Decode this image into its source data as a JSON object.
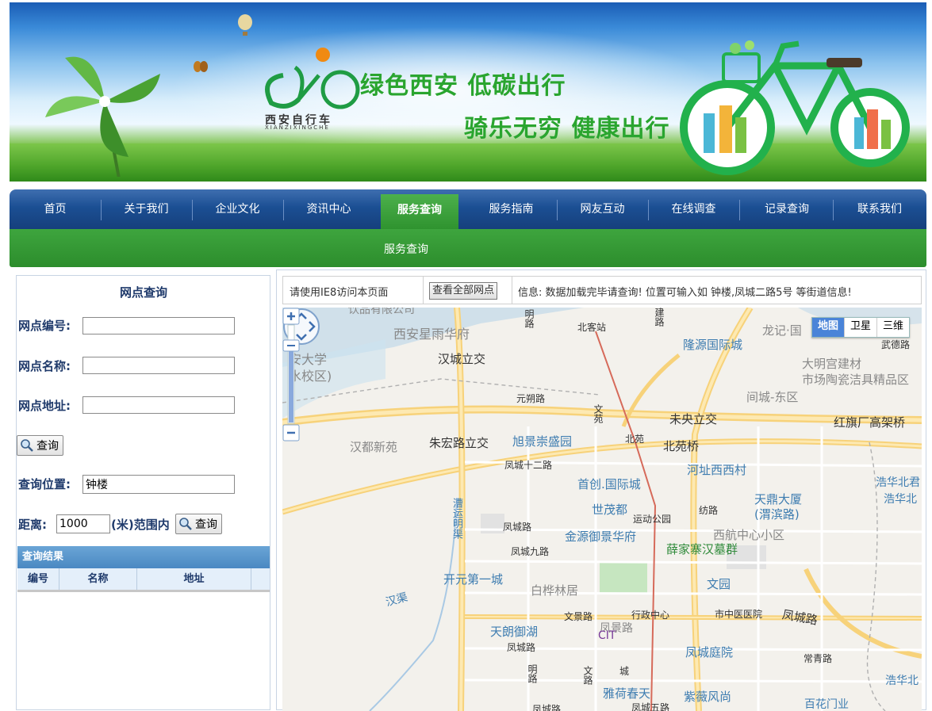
{
  "banner": {
    "logo_text": "西安自行车",
    "logo_sub": "XIANZIXINGCHE",
    "slogan1": "绿色西安 低碳出行",
    "slogan2": "骑乐无穷 健康出行"
  },
  "nav": {
    "items": [
      {
        "label": "首页"
      },
      {
        "label": "关于我们"
      },
      {
        "label": "企业文化"
      },
      {
        "label": "资讯中心"
      },
      {
        "label": "服务查询"
      },
      {
        "label": "服务指南"
      },
      {
        "label": "网友互动"
      },
      {
        "label": "在线调查"
      },
      {
        "label": "记录查询"
      },
      {
        "label": "联系我们"
      }
    ],
    "active": "服务查询",
    "subnav": "服务查询"
  },
  "search": {
    "title": "网点查询",
    "id_label": "网点编号:",
    "id_value": "",
    "name_label": "网点名称:",
    "name_value": "",
    "addr_label": "网点地址:",
    "addr_value": "",
    "query_button": "查询",
    "pos_label": "查询位置:",
    "pos_value": "钟楼",
    "dist_label": "距离:",
    "dist_value": "1000",
    "dist_unit": "(米)范围内",
    "query_button2": "查询"
  },
  "results": {
    "title": "查询结果",
    "columns": [
      "编号",
      "名称",
      "地址"
    ]
  },
  "info_bar": {
    "hint": "请使用IE8访问本页面",
    "show_all_button": "查看全部网点",
    "message": "信息: 数据加载完毕请查询!  位置可输入如 钟楼,凤城二路5号 等街道信息!"
  },
  "map": {
    "types": [
      "地图",
      "卫星",
      "三维"
    ],
    "active_type": "地图",
    "labels": [
      {
        "text": "饮品有限公司",
        "style": "gray"
      },
      {
        "text": "西安星雨华府",
        "style": "gray"
      },
      {
        "text": "明路",
        "style": "dark"
      },
      {
        "text": "北客站",
        "style": "dark"
      },
      {
        "text": "建路",
        "style": "dark"
      },
      {
        "text": "龙记·国",
        "style": "gray"
      },
      {
        "text": "武德路",
        "style": "dark"
      },
      {
        "text": "安大学",
        "style": "gray"
      },
      {
        "text": "水校区)",
        "style": "gray"
      },
      {
        "text": "汉城立交",
        "style": "default"
      },
      {
        "text": "隆源国际城",
        "style": "blue"
      },
      {
        "text": "大明宫建材",
        "style": "gray"
      },
      {
        "text": "市场陶瓷洁具精品区",
        "style": "gray"
      },
      {
        "text": "元朔路",
        "style": "dark"
      },
      {
        "text": "间城-东区",
        "style": "gray"
      },
      {
        "text": "文苑",
        "style": "dark"
      },
      {
        "text": "未央立交",
        "style": "default"
      },
      {
        "text": "红旗厂高架桥",
        "style": "default"
      },
      {
        "text": "汉都新苑",
        "style": "gray"
      },
      {
        "text": "朱宏路立交",
        "style": "default"
      },
      {
        "text": "旭景崇盛园",
        "style": "blue"
      },
      {
        "text": "北苑",
        "style": "dark"
      },
      {
        "text": "北苑桥",
        "style": "default"
      },
      {
        "text": "凤城十二路",
        "style": "dark"
      },
      {
        "text": "河址西西村",
        "style": "blue"
      },
      {
        "text": "首创.国际城",
        "style": "blue"
      },
      {
        "text": "浩华北君",
        "style": "blue"
      },
      {
        "text": "浩华北",
        "style": "blue"
      },
      {
        "text": "世茂都",
        "style": "blue"
      },
      {
        "text": "纺路",
        "style": "dark"
      },
      {
        "text": "天鼎大厦",
        "style": "blue"
      },
      {
        "text": "(渭滨路)",
        "style": "blue"
      },
      {
        "text": "漕运明渠",
        "style": "blue"
      },
      {
        "text": "运动公园",
        "style": "dark"
      },
      {
        "text": "凤城路",
        "style": "dark"
      },
      {
        "text": "金源御景华府",
        "style": "blue"
      },
      {
        "text": "西航中心小区",
        "style": "gray"
      },
      {
        "text": "凤城九路",
        "style": "dark"
      },
      {
        "text": "薛家寨汉墓群",
        "style": "green"
      },
      {
        "text": "开元第一城",
        "style": "blue"
      },
      {
        "text": "白桦林居",
        "style": "gray"
      },
      {
        "text": "文园",
        "style": "blue"
      },
      {
        "text": "汉渠",
        "style": "blue"
      },
      {
        "text": "文景路",
        "style": "dark"
      },
      {
        "text": "行政中心",
        "style": "dark"
      },
      {
        "text": "市中医医院",
        "style": "dark"
      },
      {
        "text": "凤城路",
        "style": "default"
      },
      {
        "text": "天朗御湖",
        "style": "blue"
      },
      {
        "text": "凤景路",
        "style": "gray"
      },
      {
        "text": "CIT",
        "style": "purple"
      },
      {
        "text": "凤城庭院",
        "style": "blue"
      },
      {
        "text": "凤城路",
        "style": "dark"
      },
      {
        "text": "常青路",
        "style": "dark"
      },
      {
        "text": "明路",
        "style": "dark"
      },
      {
        "text": "文路",
        "style": "dark"
      },
      {
        "text": "城",
        "style": "dark"
      },
      {
        "text": "雅荷春天",
        "style": "blue"
      },
      {
        "text": "紫薇风尚",
        "style": "blue"
      },
      {
        "text": "浩华北",
        "style": "blue"
      },
      {
        "text": "凤城五路",
        "style": "dark"
      },
      {
        "text": "凤城路",
        "style": "dark"
      },
      {
        "text": "百花门业",
        "style": "blue"
      }
    ]
  },
  "colors": {
    "nav_blue": "#1b4f93",
    "nav_green": "#2f932f",
    "label_navy": "#1f3a6b",
    "result_blue": "#4a88c2"
  }
}
